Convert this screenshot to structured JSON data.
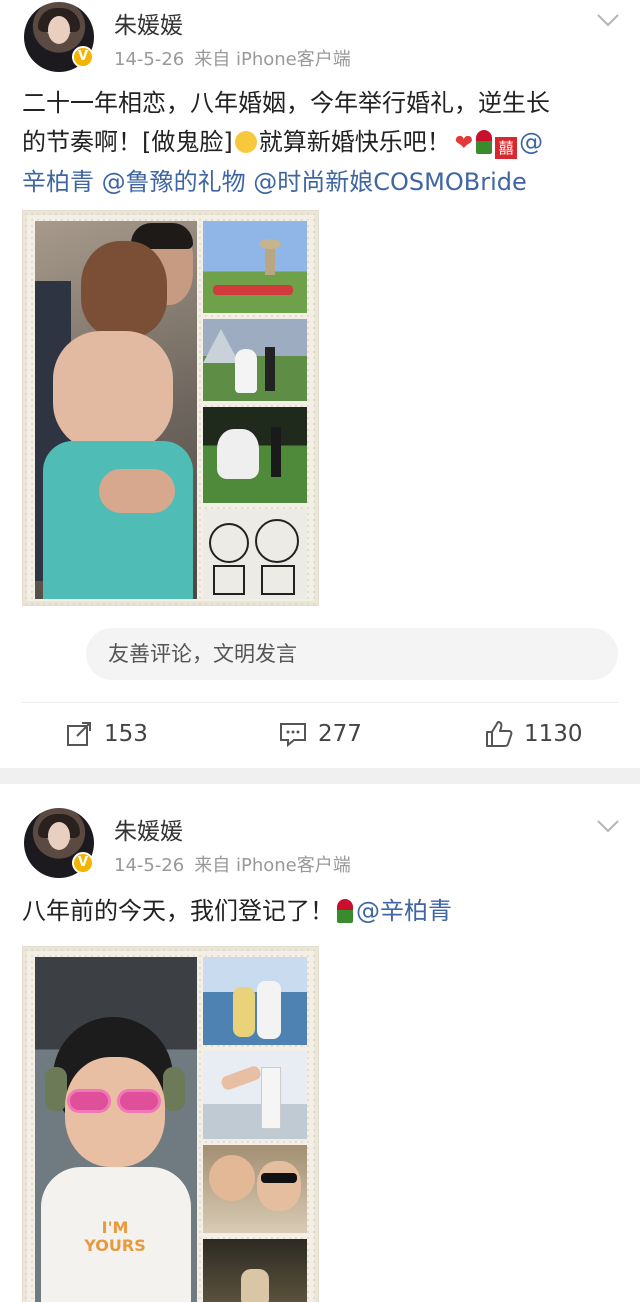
{
  "posts": [
    {
      "user": "朱媛媛",
      "date": "14-5-26",
      "source": "来自 iPhone客户端",
      "text_line1": "二十一年相恋，八年婚姻，今年举行婚礼，逆生长",
      "text_line2_a": "的节奏啊！[做鬼脸]",
      "text_line2_b": "就算新婚快乐吧！",
      "text_line2_mention": "@",
      "text_line3_m1": "辛柏青",
      "text_line3_m2": " @鲁豫的礼物",
      "text_line3_m3": " @时尚新娘COSMOBride",
      "comment_placeholder": "友善评论，文明发言",
      "reposts": "153",
      "comments": "277",
      "likes": "1130"
    },
    {
      "user": "朱媛媛",
      "date": "14-5-26",
      "source": "来自 iPhone客户端",
      "text_main": "八年前的今天，我们登记了！",
      "text_mention": "@辛柏青",
      "shirt_text": "I'M YOURS"
    }
  ],
  "icons": {
    "verified": "verified-v-badge",
    "menu": "chevron-down-icon",
    "repost": "share-icon",
    "comment": "comment-icon",
    "like": "thumbs-up-icon"
  },
  "colors": {
    "mention": "#3f66a3",
    "verified": "#f5b400",
    "meta": "#999999"
  }
}
